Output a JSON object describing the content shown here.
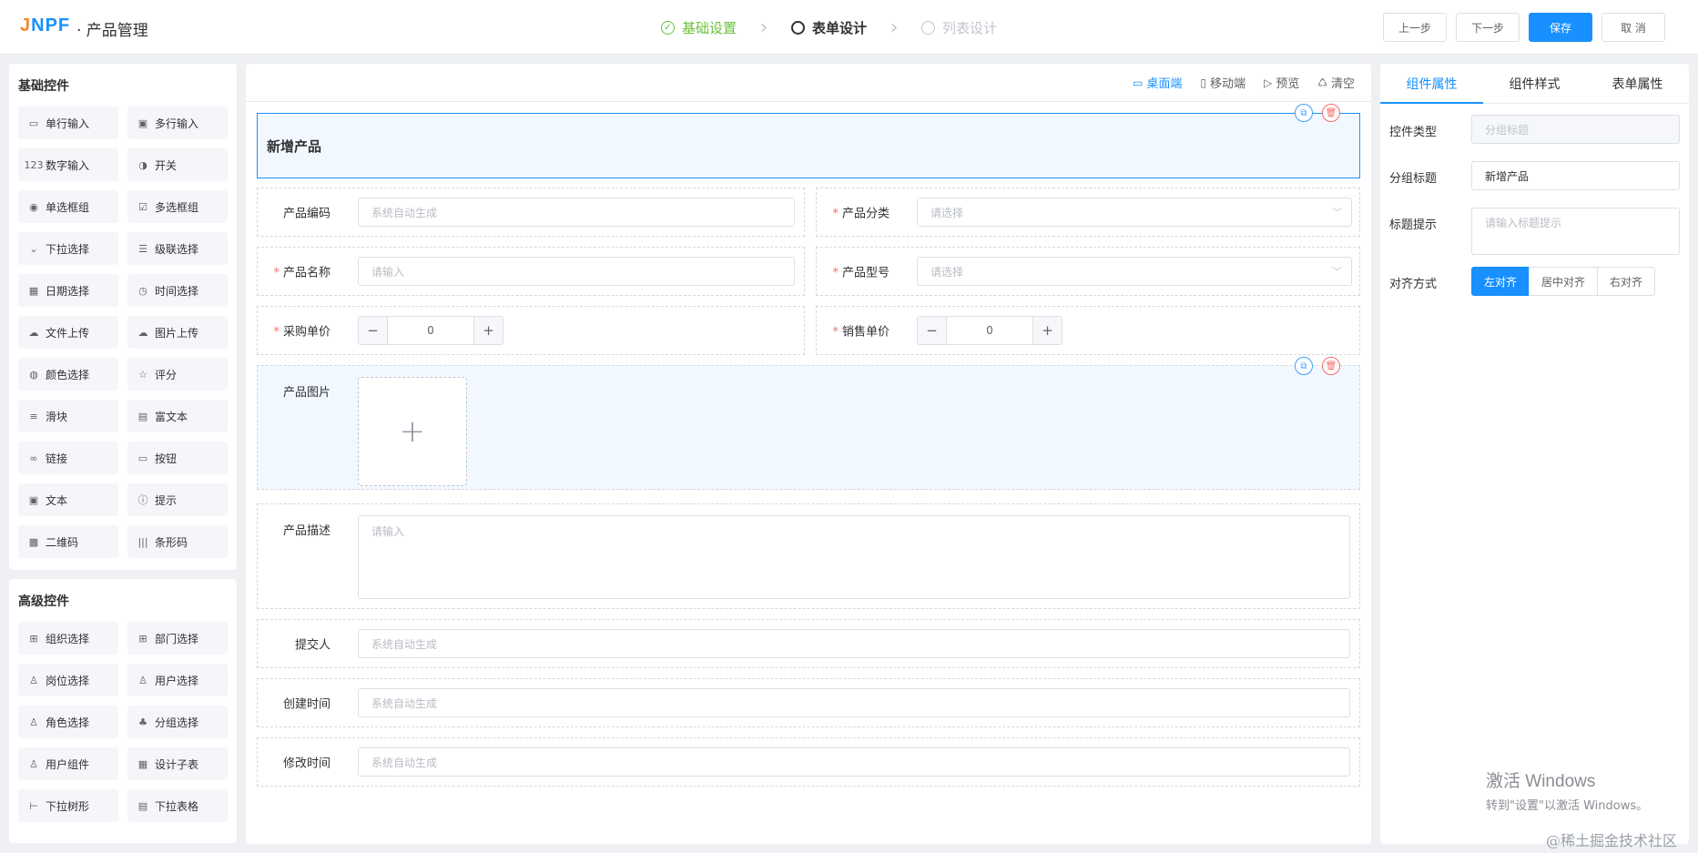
{
  "header": {
    "logo_j": "J",
    "logo_rest": "NPF",
    "app_title": "· 产品管理",
    "steps": [
      {
        "label": "基础设置",
        "state": "done"
      },
      {
        "label": "表单设计",
        "state": "active"
      },
      {
        "label": "列表设计",
        "state": "todo"
      }
    ],
    "buttons": {
      "prev": "上一步",
      "next": "下一步",
      "save": "保存",
      "cancel": "取 消"
    }
  },
  "palette": {
    "basic_title": "基础控件",
    "basic_items": [
      {
        "label": "单行输入",
        "icon": "input-icon",
        "glyph": "▭"
      },
      {
        "label": "多行输入",
        "icon": "textarea-icon",
        "glyph": "▣"
      },
      {
        "label": "数字输入",
        "icon": "number-icon",
        "glyph": "123"
      },
      {
        "label": "开关",
        "icon": "switch-icon",
        "glyph": "◑"
      },
      {
        "label": "单选框组",
        "icon": "radio-icon",
        "glyph": "◉"
      },
      {
        "label": "多选框组",
        "icon": "checkbox-icon",
        "glyph": "☑"
      },
      {
        "label": "下拉选择",
        "icon": "select-icon",
        "glyph": "⌄"
      },
      {
        "label": "级联选择",
        "icon": "cascader-icon",
        "glyph": "☰"
      },
      {
        "label": "日期选择",
        "icon": "date-icon",
        "glyph": "▦"
      },
      {
        "label": "时间选择",
        "icon": "clock-icon",
        "glyph": "◷"
      },
      {
        "label": "文件上传",
        "icon": "upload-cloud-icon",
        "glyph": "☁"
      },
      {
        "label": "图片上传",
        "icon": "image-upload-icon",
        "glyph": "☁"
      },
      {
        "label": "颜色选择",
        "icon": "palette-icon",
        "glyph": "◍"
      },
      {
        "label": "评分",
        "icon": "star-icon",
        "glyph": "☆"
      },
      {
        "label": "滑块",
        "icon": "slider-icon",
        "glyph": "≡"
      },
      {
        "label": "富文本",
        "icon": "richtext-icon",
        "glyph": "▤"
      },
      {
        "label": "链接",
        "icon": "link-icon",
        "glyph": "∞"
      },
      {
        "label": "按钮",
        "icon": "button-icon",
        "glyph": "▭"
      },
      {
        "label": "文本",
        "icon": "text-icon",
        "glyph": "▣"
      },
      {
        "label": "提示",
        "icon": "alert-icon",
        "glyph": "ⓘ"
      },
      {
        "label": "二维码",
        "icon": "qrcode-icon",
        "glyph": "▩"
      },
      {
        "label": "条形码",
        "icon": "barcode-icon",
        "glyph": "|||"
      }
    ],
    "adv_title": "高级控件",
    "adv_items": [
      {
        "label": "组织选择",
        "icon": "org-icon",
        "glyph": "⊞"
      },
      {
        "label": "部门选择",
        "icon": "dept-icon",
        "glyph": "⊞"
      },
      {
        "label": "岗位选择",
        "icon": "post-icon",
        "glyph": "♙"
      },
      {
        "label": "用户选择",
        "icon": "user-icon",
        "glyph": "♙"
      },
      {
        "label": "角色选择",
        "icon": "role-icon",
        "glyph": "♙"
      },
      {
        "label": "分组选择",
        "icon": "group-icon",
        "glyph": "♣"
      },
      {
        "label": "用户组件",
        "icon": "user-component-icon",
        "glyph": "♙"
      },
      {
        "label": "设计子表",
        "icon": "table-icon",
        "glyph": "▦"
      },
      {
        "label": "下拉树形",
        "icon": "tree-icon",
        "glyph": "⊢"
      },
      {
        "label": "下拉表格",
        "icon": "dropdown-table-icon",
        "glyph": "▤"
      }
    ]
  },
  "canvas": {
    "toolbar": [
      {
        "label": "桌面端",
        "icon": "desktop-icon",
        "glyph": "▭",
        "active": true
      },
      {
        "label": "移动端",
        "icon": "mobile-icon",
        "glyph": "▯",
        "active": false
      },
      {
        "label": "预览",
        "icon": "preview-icon",
        "glyph": "▷",
        "active": false
      },
      {
        "label": "清空",
        "icon": "clear-icon",
        "glyph": "♺",
        "active": false
      }
    ],
    "group_title": "新增产品",
    "fields": {
      "code": {
        "label": "产品编码",
        "placeholder": "系统自动生成"
      },
      "category": {
        "label": "产品分类",
        "placeholder": "请选择"
      },
      "name": {
        "label": "产品名称",
        "placeholder": "请输入"
      },
      "model": {
        "label": "产品型号",
        "placeholder": "请选择"
      },
      "purchase_price": {
        "label": "采购单价",
        "value": "0"
      },
      "sale_price": {
        "label": "销售单价",
        "value": "0"
      },
      "image": {
        "label": "产品图片"
      },
      "description": {
        "label": "产品描述",
        "placeholder": "请输入"
      },
      "submitter": {
        "label": "提交人",
        "placeholder": "系统自动生成"
      },
      "created": {
        "label": "创建时间",
        "placeholder": "系统自动生成"
      },
      "modified": {
        "label": "修改时间",
        "placeholder": "系统自动生成"
      }
    },
    "required_mark": "*"
  },
  "props": {
    "tabs": [
      "组件属性",
      "组件样式",
      "表单属性"
    ],
    "control_type_label": "控件类型",
    "control_type_value": "分组标题",
    "group_title_label": "分组标题",
    "group_title_value": "新增产品",
    "tip_label": "标题提示",
    "tip_placeholder": "请输入标题提示",
    "align_label": "对齐方式",
    "align_options": [
      "左对齐",
      "居中对齐",
      "右对齐"
    ]
  },
  "overlay": {
    "activate_line1": "激活 Windows",
    "activate_line2": "转到\"设置\"以激活 Windows。",
    "credit": "@稀土掘金技术社区"
  },
  "colors": {
    "accent": "#1890ff",
    "success": "#67c23a",
    "danger": "#f56c6c"
  }
}
